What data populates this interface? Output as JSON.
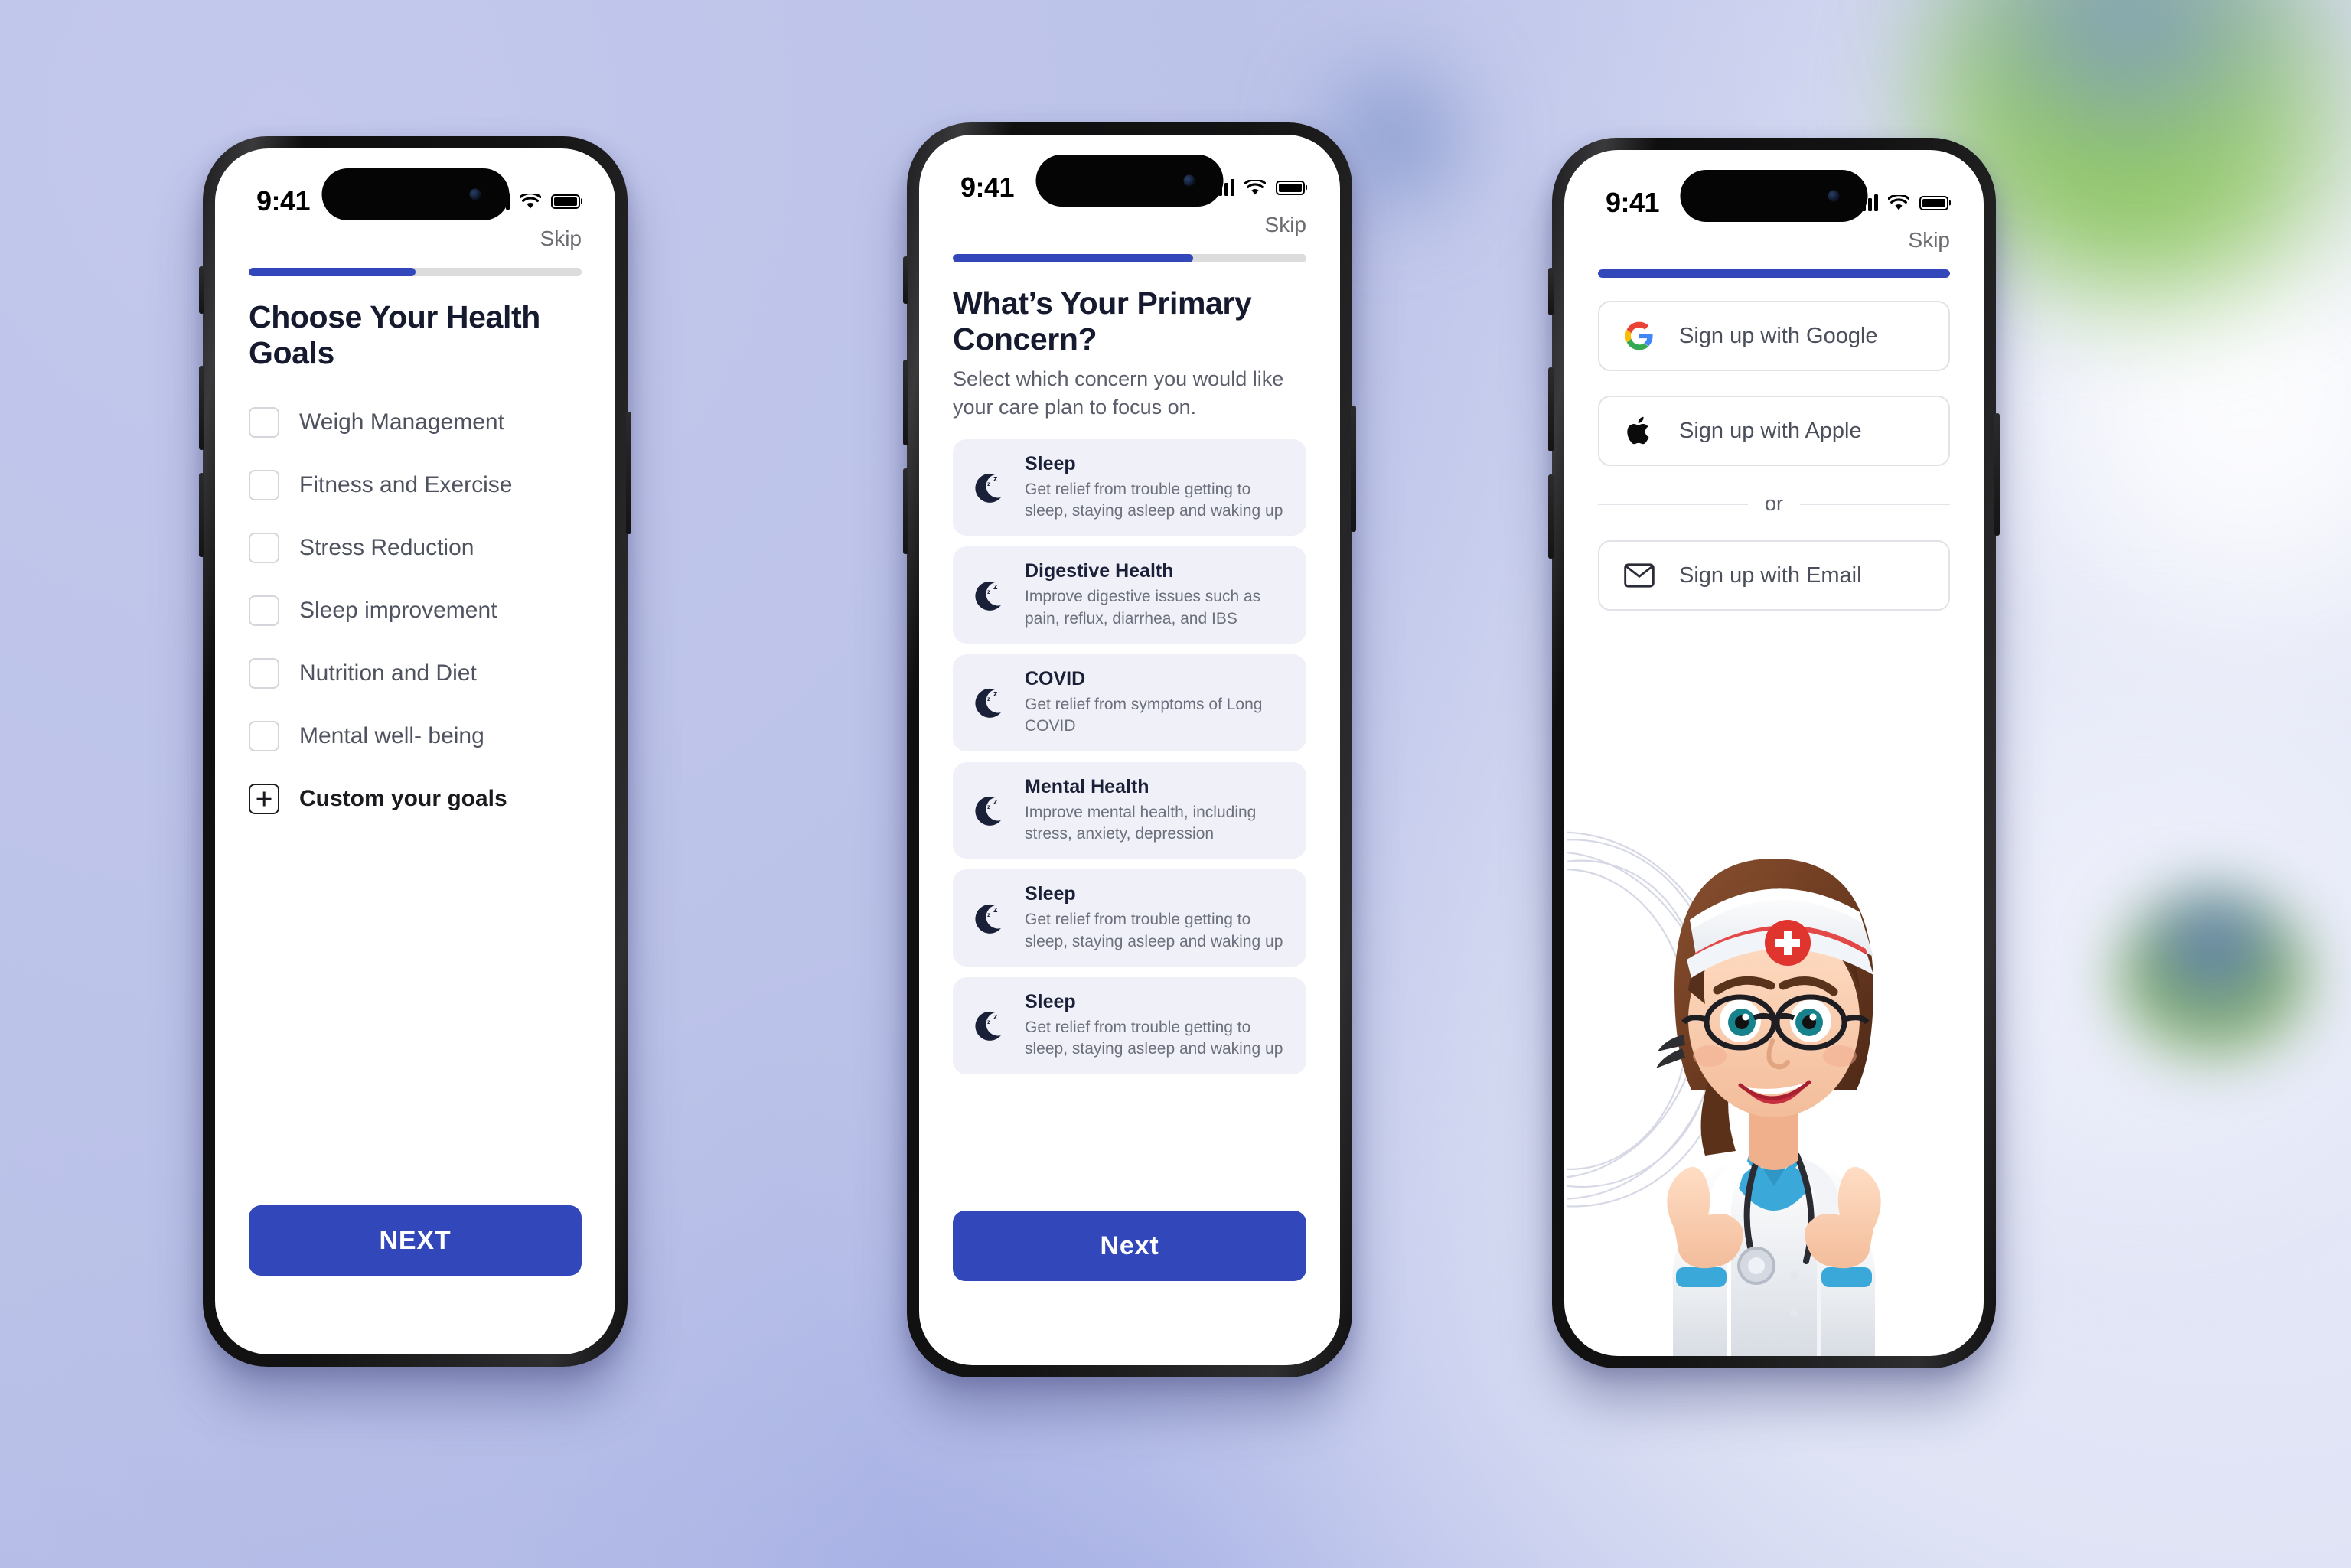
{
  "background": {
    "base_color": "#bcc3e9",
    "accent_green": "#9ccd74",
    "accent_blue": "#7f99c4"
  },
  "theme": {
    "primary": "#3247ba",
    "card_bg": "#f0f1f8",
    "title_color": "#161a2e",
    "muted_text": "#6c707c"
  },
  "status_bar": {
    "time": "9:41",
    "cellular_icon": "signal-bars-icon",
    "wifi_icon": "wifi-icon",
    "battery_icon": "battery-icon"
  },
  "screens": [
    {
      "id": "health-goals",
      "skip_label": "Skip",
      "progress_percent": 50,
      "title": "Choose Your Health Goals",
      "goals": [
        {
          "label": "Weigh Management",
          "checked": false
        },
        {
          "label": "Fitness and Exercise",
          "checked": false
        },
        {
          "label": "Stress Reduction",
          "checked": false
        },
        {
          "label": "Sleep improvement",
          "checked": false
        },
        {
          "label": "Nutrition and Diet",
          "checked": false
        },
        {
          "label": "Mental well- being",
          "checked": false
        }
      ],
      "custom_goal_label": "Custom your goals",
      "custom_goal_icon": "plus-box-icon",
      "next_button": "NEXT"
    },
    {
      "id": "primary-concern",
      "skip_label": "Skip",
      "progress_percent": 68,
      "title": "What’s Your Primary Concern?",
      "subtitle": "Select which concern you would like your care plan to focus on.",
      "concerns": [
        {
          "icon": "sleep-moon-icon",
          "title": "Sleep",
          "desc": "Get relief from trouble getting to sleep, staying asleep and waking up"
        },
        {
          "icon": "sleep-moon-icon",
          "title": "Digestive Health",
          "desc": "Improve digestive issues such as pain, reflux, diarrhea, and IBS"
        },
        {
          "icon": "sleep-moon-icon",
          "title": "COVID",
          "desc": "Get relief from symptoms of Long COVID"
        },
        {
          "icon": "sleep-moon-icon",
          "title": "Mental Health",
          "desc": "Improve mental health, including stress, anxiety, depression"
        },
        {
          "icon": "sleep-moon-icon",
          "title": "Sleep",
          "desc": "Get relief from trouble getting to sleep, staying asleep and waking up"
        },
        {
          "icon": "sleep-moon-icon",
          "title": "Sleep",
          "desc": "Get relief from trouble getting to sleep, staying asleep and waking up"
        }
      ],
      "next_button": "Next"
    },
    {
      "id": "signup",
      "skip_label": "Skip",
      "progress_percent": 100,
      "providers": [
        {
          "icon": "google-icon",
          "label": "Sign up with Google"
        },
        {
          "icon": "apple-icon",
          "label": "Sign up with Apple"
        }
      ],
      "divider_label": "or",
      "email_provider": {
        "icon": "envelope-icon",
        "label": "Sign up with Email"
      },
      "illustration": "nurse-thumbs-up-illustration"
    }
  ]
}
